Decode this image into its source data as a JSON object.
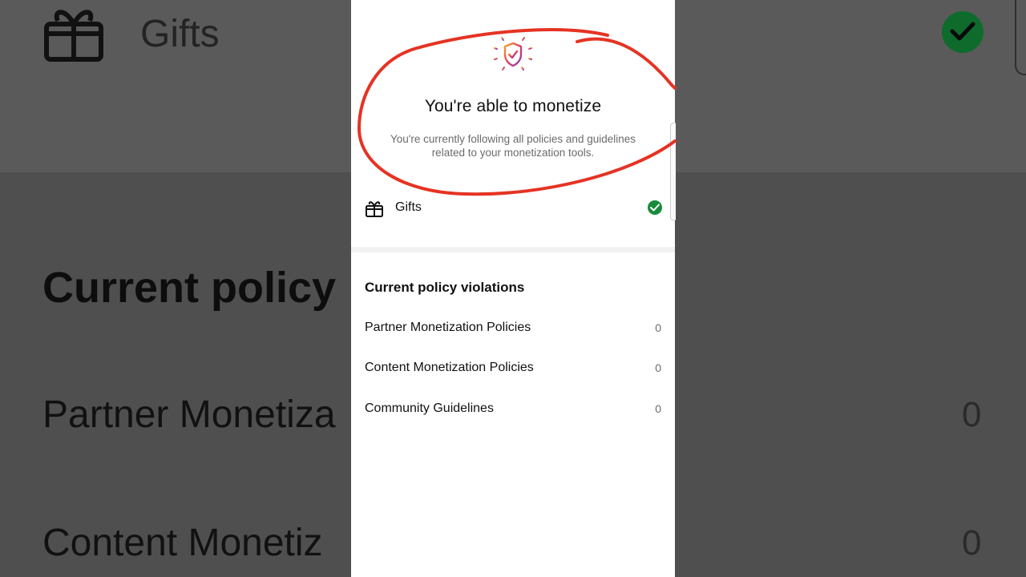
{
  "background": {
    "gifts_label": "Gifts",
    "heading": "Current policy",
    "row1": "Partner Monetiza",
    "row2": "Content Monetiz",
    "count1": "0",
    "count2": "0"
  },
  "status": {
    "title": "You're able to monetize",
    "subtitle": "You're currently following all policies and guidelines related to your monetization tools.",
    "icon": "shield-check-icon"
  },
  "tools": [
    {
      "label": "Gifts",
      "icon": "gift-icon",
      "status": "check-icon",
      "status_color": "#1a8a3c"
    }
  ],
  "violations": {
    "title": "Current policy violations",
    "items": [
      {
        "label": "Partner Monetization Policies",
        "count": "0"
      },
      {
        "label": "Content Monetization Policies",
        "count": "0"
      },
      {
        "label": "Community Guidelines",
        "count": "0"
      }
    ]
  },
  "colors": {
    "annotation": "#e53324",
    "success": "#1a8a3c",
    "dim_background": "#4f4f4f"
  }
}
